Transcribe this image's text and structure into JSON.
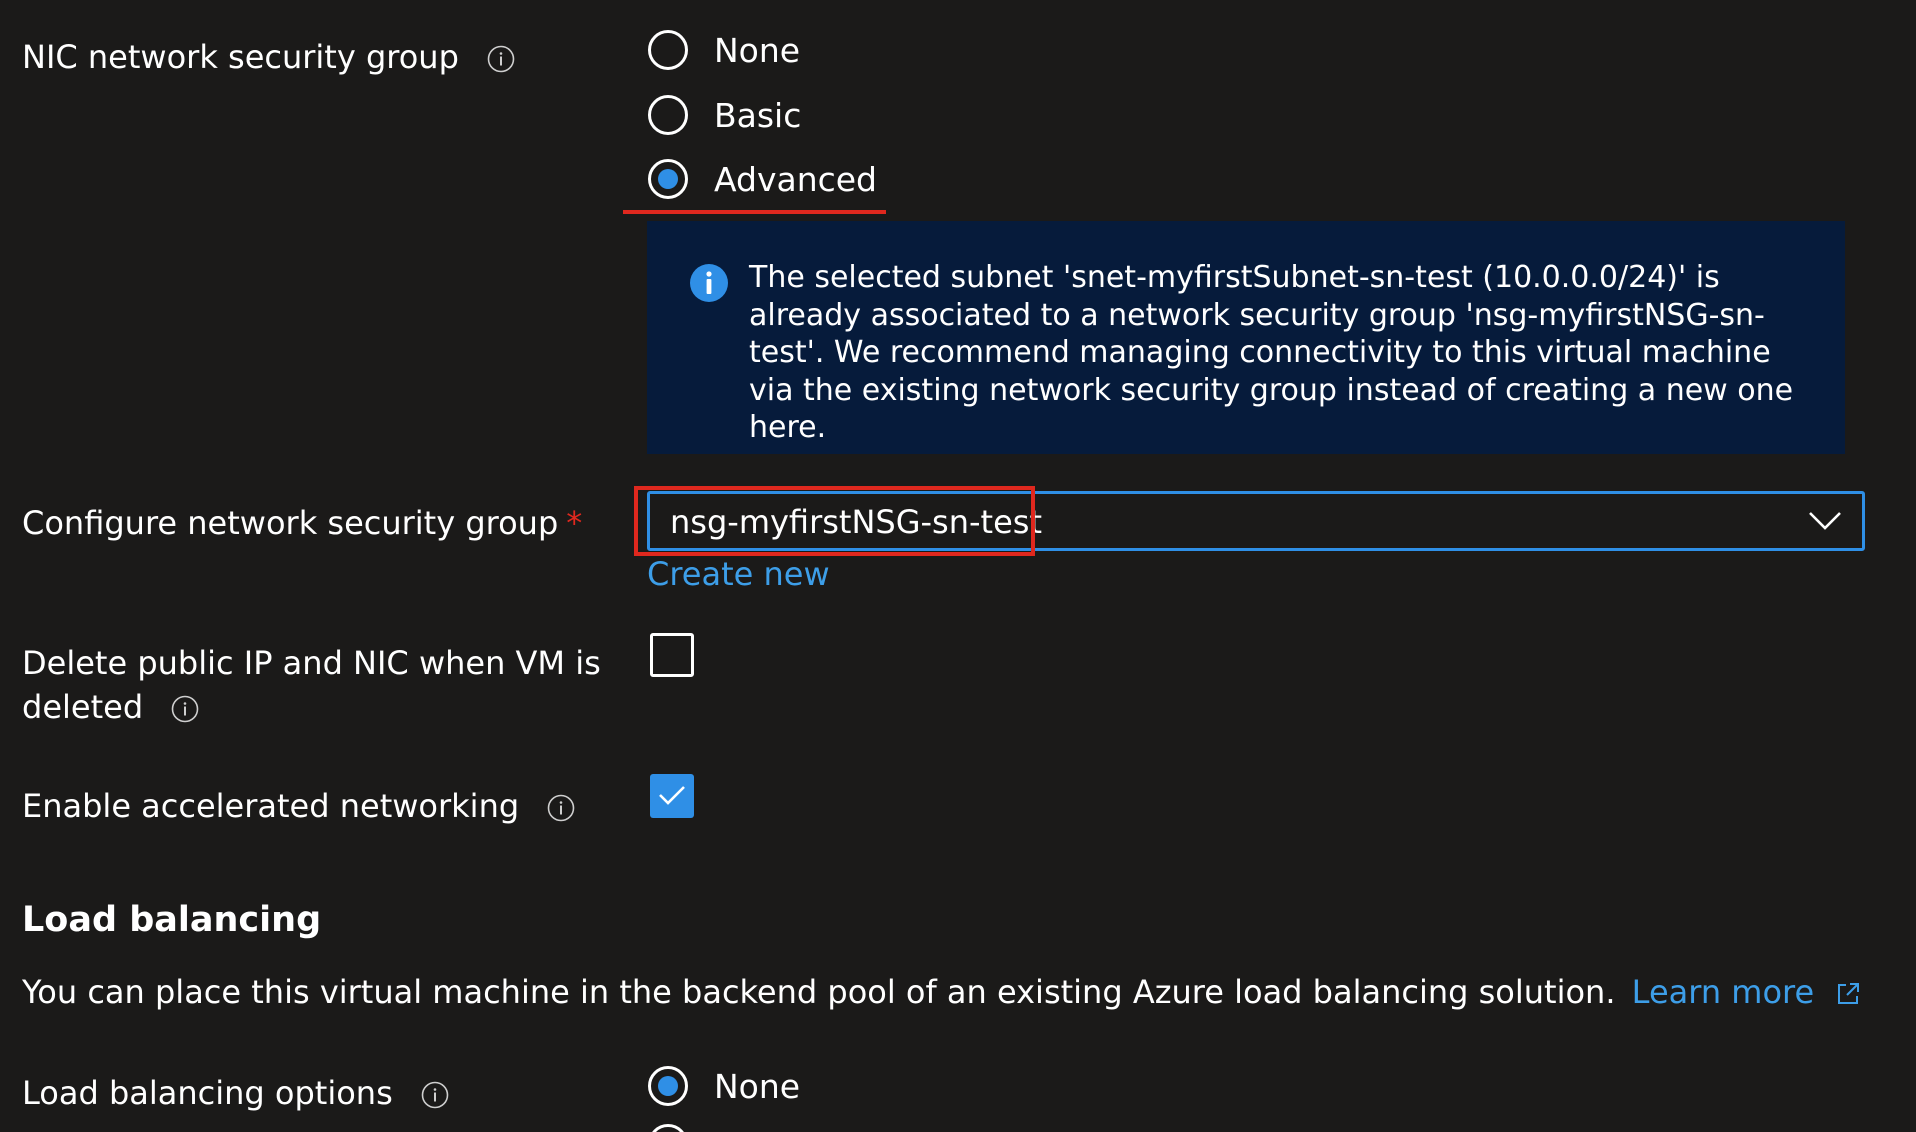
{
  "nsg": {
    "label": "NIC network security group",
    "options": [
      {
        "label": "None",
        "checked": false
      },
      {
        "label": "Basic",
        "checked": false
      },
      {
        "label": "Advanced",
        "checked": true
      }
    ]
  },
  "info_banner": {
    "text": "The selected subnet 'snet-myfirstSubnet-sn-test (10.0.0.0/24)' is already associated to a network security group 'nsg-myfirstNSG-sn-test'. We recommend managing connectivity to this virtual machine via the existing network security group instead of creating a new one here."
  },
  "configure_nsg": {
    "label": "Configure network security group",
    "required_mark": "*",
    "selected_value": "nsg-myfirstNSG-sn-test",
    "create_new_link": "Create new"
  },
  "delete_public_ip": {
    "label_line1": "Delete public IP and NIC when VM is",
    "label_line2": "deleted",
    "checked": false
  },
  "accelerated_networking": {
    "label": "Enable accelerated networking",
    "checked": true
  },
  "load_balancing": {
    "title": "Load balancing",
    "description": "You can place this virtual machine in the backend pool of an existing Azure load balancing solution.",
    "learn_more": "Learn more",
    "options_label": "Load balancing options",
    "options": [
      {
        "label": "None",
        "checked": true
      }
    ]
  },
  "colors": {
    "background": "#1b1a19",
    "accent": "#2f8fe6",
    "link": "#3d9ee8",
    "highlight": "#e0281e",
    "banner": "#061b3b"
  }
}
